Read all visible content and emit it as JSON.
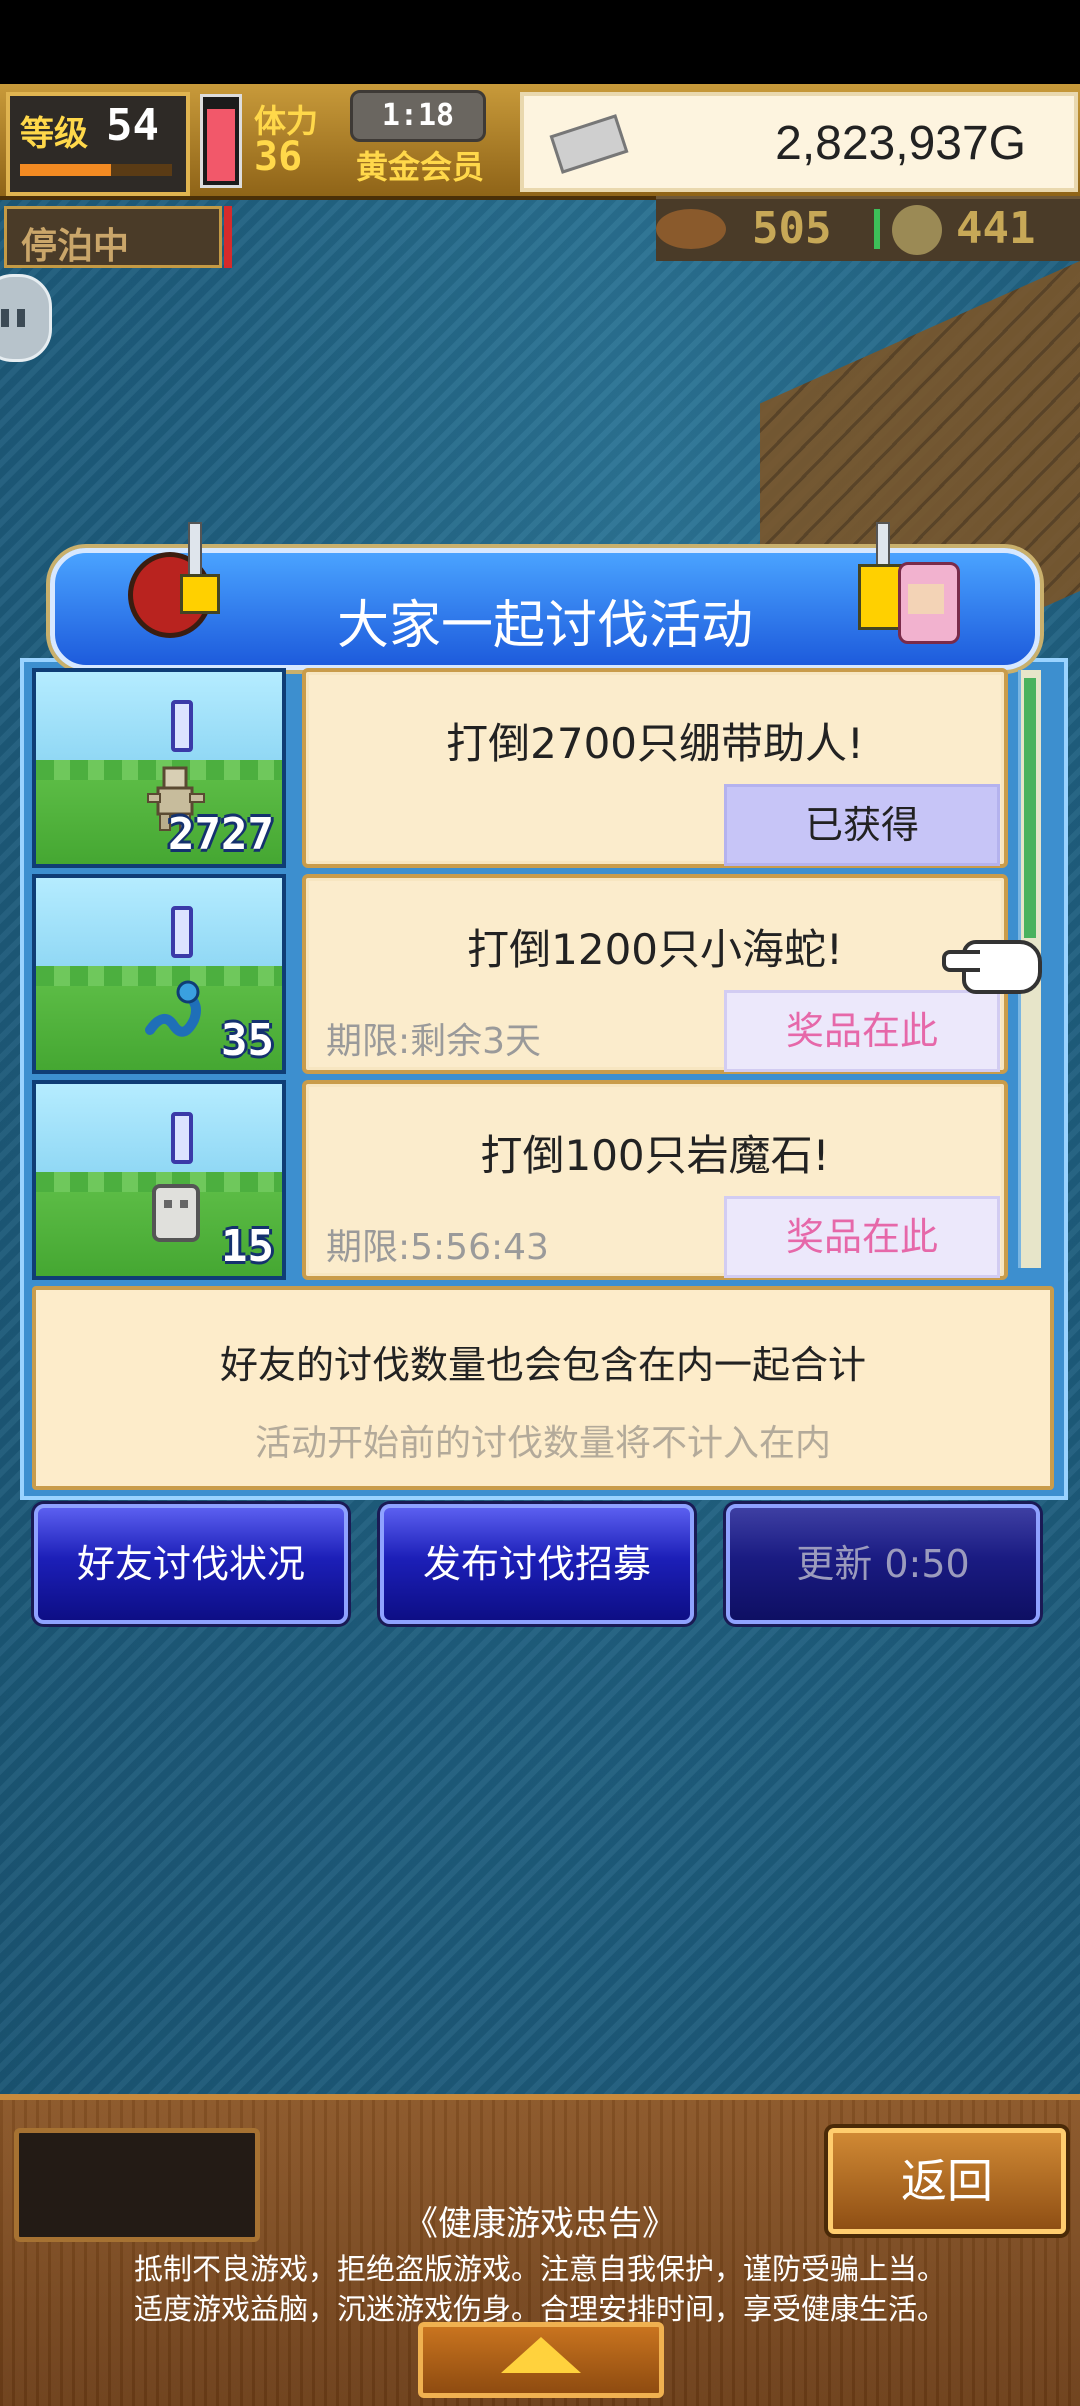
{
  "hud": {
    "level_label": "等级",
    "level": "54",
    "stamina_label": "体力",
    "stamina": "36",
    "timer": "1:18",
    "member": "黄金会员",
    "gold": "2,823,937G"
  },
  "status": {
    "docked": "停泊中",
    "resource1": "505",
    "resource2": "441"
  },
  "event": {
    "title": "大家一起讨伐活动",
    "quests": [
      {
        "count": "2727",
        "title": "打倒2700只绷带助人!",
        "deadline": "",
        "button": "已获得"
      },
      {
        "count": "35",
        "title": "打倒1200只小海蛇!",
        "deadline": "期限:剩余3天",
        "button": "奖品在此"
      },
      {
        "count": "15",
        "title": "打倒100只岩魔石!",
        "deadline": "期限:5:56:43",
        "button": "奖品在此"
      }
    ],
    "info_line1": "好友的讨伐数量也会包含在内一起合计",
    "info_line2": "活动开始前的讨伐数量将不计入在内"
  },
  "actions": {
    "friend_status": "好友讨伐状况",
    "publish_recruit": "发布讨伐招募",
    "refresh": "更新 0:50"
  },
  "bottom": {
    "back": "返回",
    "notice_title": "《健康游戏忠告》",
    "notice_line1": "抵制不良游戏，拒绝盗版游戏。注意自我保护，谨防受骗上当。",
    "notice_line2": "适度游戏益脑，沉迷游戏伤身。合理安排时间，享受健康生活。"
  },
  "colors": {
    "header_blue": "#1d5bdc",
    "card_cream": "#fbeccc",
    "prize_pink": "#e668a9",
    "button_navy": "#1c1fb8"
  }
}
